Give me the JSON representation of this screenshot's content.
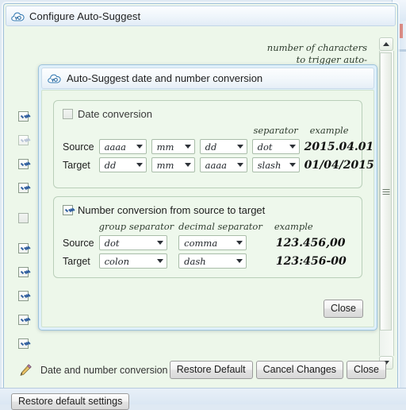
{
  "outer_window": {
    "title": "Configure Auto-Suggest",
    "icon": "cloud-icon",
    "hint_line1": "number of characters",
    "hint_line2": "to trigger auto-",
    "pencil_row_label": "Date and number conversion",
    "pencil_icon": "pencil-icon",
    "buttons": {
      "restore_default": "Restore Default",
      "cancel_changes": "Cancel Changes",
      "close": "Close"
    },
    "checkbox_column": [
      {
        "state": "checked"
      },
      {
        "state": "dim"
      },
      {
        "state": "checked"
      },
      {
        "state": "checked"
      },
      {
        "state": "empty"
      },
      {
        "state": "checked"
      },
      {
        "state": "checked"
      },
      {
        "state": "checked"
      },
      {
        "state": "checked"
      },
      {
        "state": "checked"
      }
    ],
    "scrollbar": {
      "up_arrow": "scroll-up-arrow-icon",
      "down_arrow": "scroll-down-arrow-icon"
    }
  },
  "background_bar": {
    "clipped_button": "Restore default settings"
  },
  "inner_dialog": {
    "title": "Auto-Suggest date and number conversion",
    "icon": "cloud-icon",
    "close_label": "Close",
    "date_group": {
      "checkbox_label": "Date conversion",
      "checkbox_state": "unchecked",
      "headers": {
        "part1": "",
        "part2": "",
        "part3": "",
        "separator": "separator",
        "example": "example"
      },
      "rows": [
        {
          "label": "Source",
          "part1": "aaaa",
          "part2": "mm",
          "part3": "dd",
          "separator": "dot",
          "example": "2015.04.01"
        },
        {
          "label": "Target",
          "part1": "dd",
          "part2": "mm",
          "part3": "aaaa",
          "separator": "slash",
          "example": "01/04/2015"
        }
      ]
    },
    "number_group": {
      "checkbox_label": "Number conversion from source to target",
      "checkbox_state": "checked",
      "headers": {
        "group_separator": "group separator",
        "decimal_separator": "decimal separator",
        "example": "example"
      },
      "rows": [
        {
          "label": "Source",
          "group_separator": "dot",
          "decimal_separator": "comma",
          "example": "123.456,00"
        },
        {
          "label": "Target",
          "group_separator": "colon",
          "decimal_separator": "dash",
          "example": "123:456-00"
        }
      ]
    }
  },
  "colors": {
    "panel_green": "#edf7ea",
    "group_border": "#b9cfb9",
    "dialog_border": "#9dc3dc",
    "titlebar": "#eff5fb",
    "check_blue": "#2e5d9e",
    "desktop_blue": "#dfe9f3"
  }
}
